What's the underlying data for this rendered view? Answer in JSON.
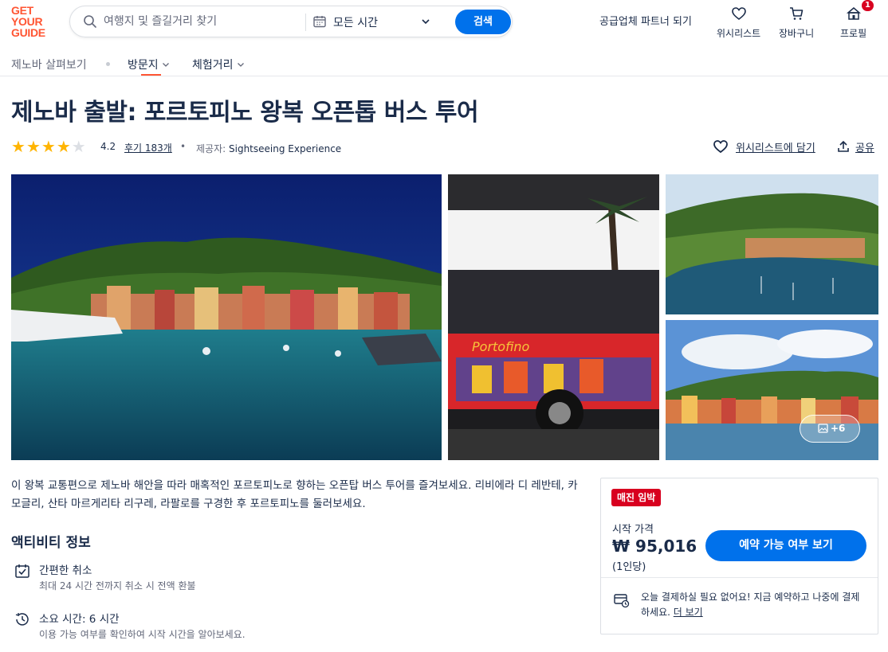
{
  "header": {
    "logo_lines": [
      "GET",
      "YOUR",
      "GUIDE"
    ],
    "search_placeholder": "여행지 및 즐길거리 찾기",
    "time_select": "모든 시간",
    "search_button": "검색",
    "partner_link": "공급업체 파트너 되기",
    "wishlist_label": "위시리스트",
    "cart_label": "장바구니",
    "profile_label": "프로필",
    "profile_badge": "1"
  },
  "subnav": {
    "home": "제노바 살펴보기",
    "places": "방문지",
    "activities": "체험거리"
  },
  "product": {
    "title": "제노바 출발: 포르토피노 왕복 오픈톱 버스 투어",
    "rating": "4.2",
    "rating_stars": 4,
    "reviews": "후기 183개",
    "provider_label": "제공자:",
    "provider_name": "Sightseeing Experience",
    "wishlist_action": "위시리스트에 담기",
    "share_action": "공유",
    "more_photos": "+6",
    "description": "이 왕복 교통편으로 제노바 해안을 따라 매혹적인 포르토피노로 향하는 오픈탑 버스 투어를 즐겨보세요. 리비에라 디 레반테, 카모글리, 산타 마르게리타 리구레, 라팔로를 구경한 후 포르토피노를 둘러보세요."
  },
  "info": {
    "heading": "액티비티 정보",
    "items": [
      {
        "title": "간편한 취소",
        "subtitle": "최대 24 시간 전까지 취소 시 전액 환불",
        "icon": "calendar-check-icon"
      },
      {
        "title": "소요 시간: 6 시간",
        "subtitle": "이용 가능 여부를 확인하여 시작 시간을 알아보세요.",
        "icon": "clock-icon"
      }
    ]
  },
  "booking": {
    "tag": "매진 임박",
    "from_label": "시작 가격",
    "price": "₩ 95,016",
    "per": "(1인당)",
    "cta": "예약 가능 여부 보기",
    "later_text": "오늘 결제하실 필요 없어요! 지금 예약하고 나중에 결제하세요.",
    "later_link": "더 보기"
  },
  "colors": {
    "brand": "#ff5533",
    "primary": "#0071eb",
    "text": "#1a2b49",
    "tag_red": "#d8001f",
    "star": "#ffb400"
  }
}
